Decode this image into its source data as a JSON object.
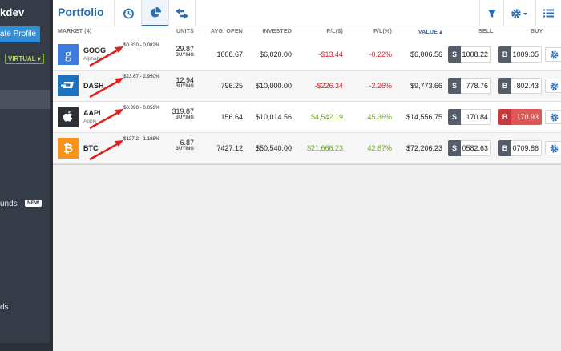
{
  "sidebar": {
    "username": "kdev",
    "create_profile_label": "ate Profile",
    "account_mode": "VIRTUAL ▾",
    "funds_label": "unds",
    "funds_badge": "NEW",
    "other_label": "ds"
  },
  "header": {
    "title": "Portfolio",
    "tabs": [
      {
        "icon": "history-icon"
      },
      {
        "icon": "pie-chart-icon"
      },
      {
        "icon": "transfer-arrows-icon"
      }
    ],
    "tools": [
      {
        "icon": "filter-icon"
      },
      {
        "icon": "gear-dropdown-icon"
      },
      {
        "icon": "list-view-icon"
      }
    ]
  },
  "table": {
    "columns": {
      "market": "MARKET (4)",
      "units": "UNITS",
      "avg_open": "AVG. OPEN",
      "invested": "INVESTED",
      "pl_usd": "P/L($)",
      "pl_pct": "P/L(%)",
      "value": "VALUE ▴",
      "sell": "SELL",
      "buy": "BUY"
    },
    "rows": [
      {
        "symbol": "GOOG",
        "name": "Alphabet",
        "change": "$0.830 - 0.082%",
        "units": "29.87",
        "units_side": "BUYING",
        "avg_open": "1008.67",
        "invested": "$6,020.00",
        "pl_usd": "-$13.44",
        "pl_pct": "-0.22%",
        "value": "$6,006.56",
        "sell_label": "S",
        "sell": "1008.22",
        "buy_label": "B",
        "buy": "1009.05",
        "logo_color": "#3d7be0",
        "trend": "negative"
      },
      {
        "symbol": "DASH",
        "name": "",
        "change": "$23.67 - 2.950%",
        "units": "12.94",
        "units_side": "BUYING",
        "avg_open": "796.25",
        "invested": "$10,000.00",
        "pl_usd": "-$226.34",
        "pl_pct": "-2.26%",
        "value": "$9,773.66",
        "sell_label": "S",
        "sell": "778.76",
        "buy_label": "B",
        "buy": "802.43",
        "logo_color": "#1c75bc",
        "trend": "negative"
      },
      {
        "symbol": "AAPL",
        "name": "Apple",
        "change": "$0.090 - 0.053%",
        "units": "319.87",
        "units_side": "BUYING",
        "avg_open": "156.64",
        "invested": "$10,014.56",
        "pl_usd": "$4,542.19",
        "pl_pct": "45.36%",
        "value": "$14,556.75",
        "sell_label": "S",
        "sell": "170.84",
        "buy_label": "B",
        "buy": "170.93",
        "logo_color": "#2b2f36",
        "trend": "positive"
      },
      {
        "symbol": "BTC",
        "name": "",
        "change": "$127.2 - 1.188%",
        "units": "6.87",
        "units_side": "BUYING",
        "avg_open": "7427.12",
        "invested": "$50,540.00",
        "pl_usd": "$21,666.23",
        "pl_pct": "42.87%",
        "value": "$72,206.23",
        "sell_label": "S",
        "sell": "0582.63",
        "buy_label": "B",
        "buy": "0709.86",
        "logo_color": "#f7931a",
        "trend": "positive"
      }
    ]
  },
  "colors": {
    "accent": "#2a6eb3",
    "negative": "#d9262c",
    "positive": "#6aaa1e",
    "annotation_arrow": "#e0201c"
  }
}
